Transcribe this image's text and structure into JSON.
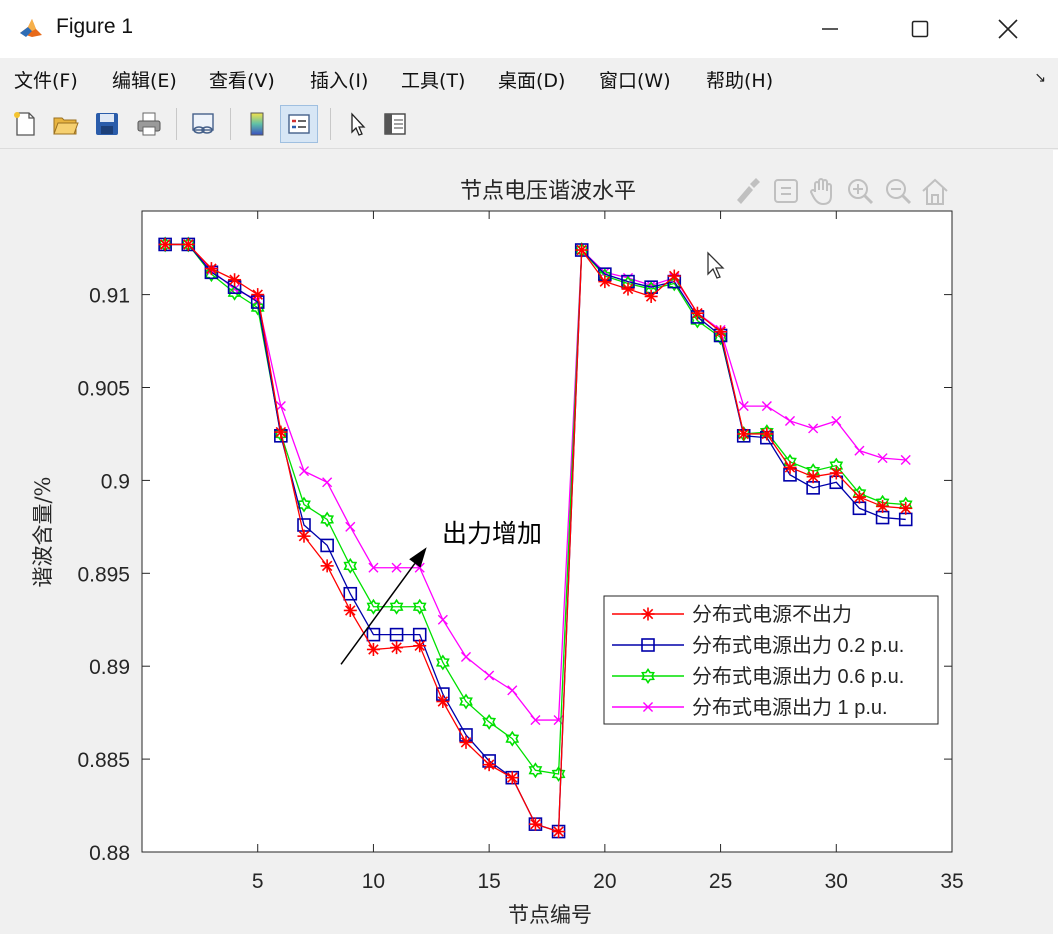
{
  "window": {
    "title": "Figure 1"
  },
  "menu": {
    "items": [
      "文件(F)",
      "编辑(E)",
      "查看(V)",
      "插入(I)",
      "工具(T)",
      "桌面(D)",
      "窗口(W)",
      "帮助(H)"
    ]
  },
  "toolbar": {
    "buttons": [
      "new-figure-icon",
      "open-file-icon",
      "save-icon",
      "print-icon",
      "link-plot-icon",
      "colorbar-icon",
      "legend-icon",
      "pointer-icon",
      "property-editor-icon"
    ],
    "axes_tools": [
      "brush-icon",
      "data-tips-icon",
      "pan-icon",
      "zoom-in-icon",
      "zoom-out-icon",
      "home-icon"
    ]
  },
  "chart_data": {
    "type": "line",
    "title": "节点电压谐波水平",
    "xlabel": "节点编号",
    "ylabel": "谐波含量/%",
    "xlim": [
      0,
      35
    ],
    "ylim": [
      0.88,
      0.9145
    ],
    "xticks": [
      5,
      10,
      15,
      20,
      25,
      30,
      35
    ],
    "xtick_labels": [
      "5",
      "10",
      "15",
      "20",
      "25",
      "30",
      "35"
    ],
    "yticks": [
      0.88,
      0.885,
      0.89,
      0.895,
      0.9,
      0.905,
      0.91
    ],
    "ytick_labels": [
      "0.88",
      "0.885",
      "0.89",
      "0.895",
      "0.9",
      "0.905",
      "0.91"
    ],
    "grid": false,
    "legend_position": "lower-right",
    "annotation": {
      "text": "出力增加",
      "arrow_from": [
        8.6,
        0.8901
      ],
      "arrow_to": [
        12.3,
        0.8964
      ]
    },
    "x": [
      1,
      2,
      3,
      4,
      5,
      6,
      7,
      8,
      9,
      10,
      11,
      12,
      13,
      14,
      15,
      16,
      17,
      18,
      19,
      20,
      21,
      22,
      23,
      24,
      25,
      26,
      27,
      28,
      29,
      30,
      31,
      32,
      33
    ],
    "series": [
      {
        "name": "分布式电源不出力",
        "color": "#ff0000",
        "marker": "asterisk",
        "values": [
          0.9127,
          0.9127,
          0.9114,
          0.9108,
          0.91,
          0.9026,
          0.897,
          0.8954,
          0.893,
          0.8909,
          0.891,
          0.8911,
          0.8881,
          0.8859,
          0.8847,
          0.884,
          0.8815,
          0.8811,
          0.9124,
          0.9107,
          0.9103,
          0.9099,
          0.911,
          0.909,
          0.908,
          0.9025,
          0.9025,
          0.9007,
          0.9002,
          0.9004,
          0.8991,
          0.8986,
          0.8985
        ]
      },
      {
        "name": "分布式电源出力 0.2 p.u.",
        "color": "#0000aa",
        "marker": "square",
        "values": [
          0.9127,
          0.9127,
          0.9112,
          0.9104,
          0.9096,
          0.9024,
          0.8976,
          0.8965,
          0.8939,
          0.8917,
          0.8917,
          0.8917,
          0.8885,
          0.8863,
          0.8849,
          0.884,
          0.8815,
          0.8811,
          0.9124,
          0.9111,
          0.9107,
          0.9104,
          0.9107,
          0.9088,
          0.9078,
          0.9024,
          0.9023,
          0.9003,
          0.8996,
          0.8999,
          0.8985,
          0.898,
          0.8979
        ]
      },
      {
        "name": "分布式电源出力 0.6 p.u.",
        "color": "#00e000",
        "marker": "hexagram",
        "values": [
          0.9127,
          0.9127,
          0.9111,
          0.9101,
          0.9093,
          0.9025,
          0.8987,
          0.8979,
          0.8954,
          0.8932,
          0.8932,
          0.8932,
          0.8902,
          0.8881,
          0.887,
          0.8861,
          0.8844,
          0.8842,
          0.9124,
          0.911,
          0.9106,
          0.9103,
          0.9106,
          0.9086,
          0.9077,
          0.9025,
          0.9026,
          0.901,
          0.9005,
          0.9008,
          0.8993,
          0.8988,
          0.8987
        ]
      },
      {
        "name": "分布式电源出力 1 p.u.",
        "color": "#ff00ff",
        "marker": "x",
        "values": [
          0.9127,
          0.9127,
          0.9113,
          0.9103,
          0.9097,
          0.904,
          0.9005,
          0.8999,
          0.8975,
          0.8953,
          0.8953,
          0.8953,
          0.8925,
          0.8905,
          0.8895,
          0.8887,
          0.8871,
          0.8871,
          0.9124,
          0.9112,
          0.9109,
          0.9105,
          0.9109,
          0.909,
          0.9081,
          0.904,
          0.904,
          0.9032,
          0.9028,
          0.9032,
          0.9016,
          0.9012,
          0.9011
        ]
      }
    ]
  }
}
